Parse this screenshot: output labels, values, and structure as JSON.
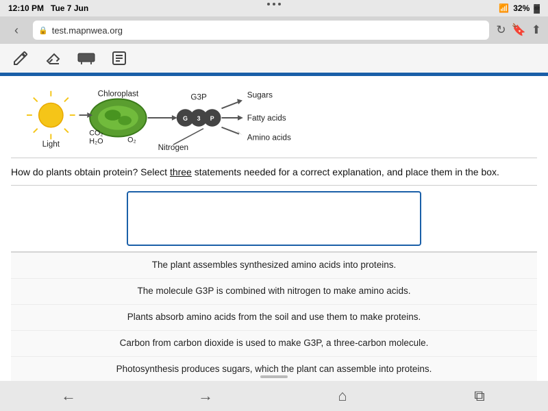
{
  "status_bar": {
    "time": "12:10 PM",
    "date": "Tue 7 Jun",
    "battery": "32%",
    "wifi": true
  },
  "browser": {
    "url": "test.mapnwea.org",
    "back_label": "‹",
    "forward_label": "›",
    "reload_label": "↻",
    "bookmark_label": "⊟",
    "share_label": "⬆"
  },
  "toolbar": {
    "pencil_label": "✏",
    "eraser_label": "◻",
    "highlight_label": "▬",
    "notes_label": "📋"
  },
  "diagram": {
    "light_label": "Light",
    "chloroplast_label": "Chloroplast",
    "g3p_label": "G3P",
    "co2_label": "CO₂",
    "h2o_label": "H₂O",
    "o2_label": "O₂",
    "nitrogen_label": "Nitrogen",
    "sugars_label": "Sugars",
    "fatty_acids_label": "Fatty acids",
    "amino_acids_label": "Amino acids"
  },
  "question": {
    "text": "How do plants obtain protein? Select three statements needed for a correct explanation, and place them in the box.",
    "underline_word": "three"
  },
  "answers": [
    {
      "id": 1,
      "text": "The plant assembles synthesized amino acids into proteins."
    },
    {
      "id": 2,
      "text": "The molecule G3P is combined with nitrogen to make amino acids."
    },
    {
      "id": 3,
      "text": "Plants absorb amino acids from the soil and use them to make proteins."
    },
    {
      "id": 4,
      "text": "Carbon from carbon dioxide is used to make G3P, a three-carbon molecule."
    },
    {
      "id": 5,
      "text": "Photosynthesis produces sugars, which the plant can assemble into proteins."
    }
  ],
  "bottom_nav": {
    "back_label": "←",
    "forward_label": "→",
    "home_label": "⌂",
    "tabs_label": "⧉"
  }
}
